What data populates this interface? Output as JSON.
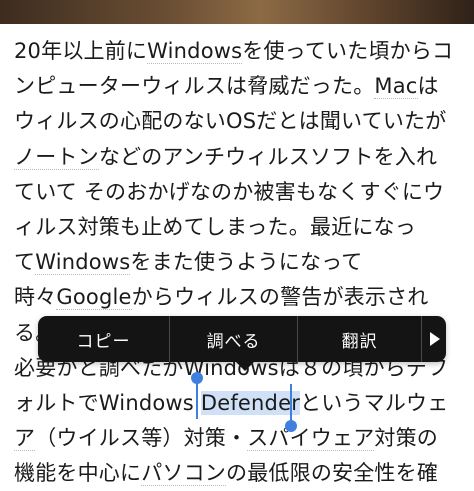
{
  "article": {
    "lines": [
      [
        "20年以上前に",
        "Windows",
        "を使っていた頃からコ"
      ],
      [
        "ンピューターウィルスは脅威だった。",
        "Mac",
        "は"
      ],
      [
        "ウィルスの心配のないOSだとは聞いていたが"
      ],
      [
        "",
        "ノートン",
        "などのアンチウィルスソフトを入れ"
      ],
      [
        "ていて そのおかげなのか被害もなくすぐにウ"
      ],
      [
        "ィルス対策も止めてしまった。最近になっ"
      ],
      [
        "て",
        "Windows",
        "をまた使うようになって"
      ],
      [
        "時々",
        "Google",
        "からウィルスの警告が表示され"
      ],
      [
        "る。"
      ],
      [
        "必要かと調べたがWindowsは８の頃からデフ"
      ],
      [
        "ォルトでWindows ",
        "Defender",
        "というマルウェ"
      ],
      [
        "",
        "ア",
        "（ウイルス等）対策・",
        "スパイウェア",
        "対策の"
      ],
      [
        "機能を中心に",
        "パソコン",
        "の最低限の安全性を確"
      ]
    ]
  },
  "context_menu": {
    "copy": "コピー",
    "lookup": "調べる",
    "translate": "翻訳",
    "more_icon": "play-triangle-icon"
  },
  "selection": {
    "text": "Defender",
    "color": "#cfe0f7",
    "handle_color": "#3f7fdf"
  }
}
